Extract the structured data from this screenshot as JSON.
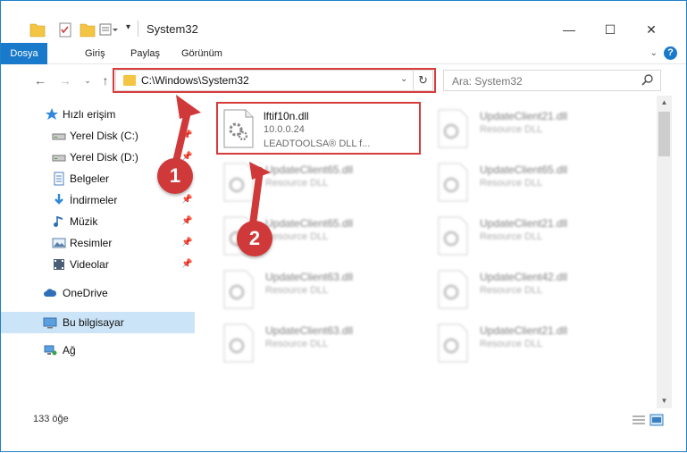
{
  "window": {
    "title": "System32",
    "controls": {
      "minimize": "—",
      "maximize": "☐",
      "close": "✕"
    }
  },
  "ribbon": {
    "tabs": [
      "Dosya",
      "Giriş",
      "Paylaş",
      "Görünüm"
    ],
    "help": "?"
  },
  "nav": {
    "address": "C:\\Windows\\System32",
    "search_placeholder": "Ara: System32"
  },
  "sidebar": {
    "items": [
      {
        "label": "Hızlı erişim",
        "icon": "star-icon",
        "pinned": false
      },
      {
        "label": "Yerel Disk (C:)",
        "icon": "drive-icon",
        "pinned": true
      },
      {
        "label": "Yerel Disk (D:)",
        "icon": "drive-icon",
        "pinned": true
      },
      {
        "label": "Belgeler",
        "icon": "documents-icon",
        "pinned": true
      },
      {
        "label": "İndirmeler",
        "icon": "download-icon",
        "pinned": true
      },
      {
        "label": "Müzik",
        "icon": "music-icon",
        "pinned": true
      },
      {
        "label": "Resimler",
        "icon": "pictures-icon",
        "pinned": true
      },
      {
        "label": "Videolar",
        "icon": "videos-icon",
        "pinned": true
      },
      {
        "label": "OneDrive",
        "icon": "cloud-icon",
        "pinned": false
      },
      {
        "label": "Bu bilgisayar",
        "icon": "computer-icon",
        "pinned": false
      },
      {
        "label": "Ağ",
        "icon": "network-icon",
        "pinned": false
      }
    ]
  },
  "files": {
    "selected": {
      "name": "lftif10n.dll",
      "version": "10.0.0.24",
      "description": "LEADTOOLSA® DLL f..."
    },
    "left_column": [
      {
        "name": "UpdateClient65.dll",
        "type": "Resource DLL"
      },
      {
        "name": "UpdateClient65.dll",
        "type": "Resource DLL"
      },
      {
        "name": "UpdateClient63.dll",
        "type": "Resource DLL"
      },
      {
        "name": "UpdateClient63.dll",
        "type": "Resource DLL"
      }
    ],
    "right_column": [
      {
        "name": "UpdateClient21.dll",
        "type": "Resource DLL"
      },
      {
        "name": "UpdateClient65.dll",
        "type": "Resource DLL"
      },
      {
        "name": "UpdateClient21.dll",
        "type": "Resource DLL"
      },
      {
        "name": "UpdateClient42.dll",
        "type": "Resource DLL"
      },
      {
        "name": "UpdateClient21.dll",
        "type": "Resource DLL"
      }
    ]
  },
  "status": {
    "count": "133 öğe"
  },
  "annotations": {
    "step1": "1",
    "step2": "2"
  },
  "colors": {
    "accent": "#1979ca",
    "annotation": "#d0393a"
  }
}
